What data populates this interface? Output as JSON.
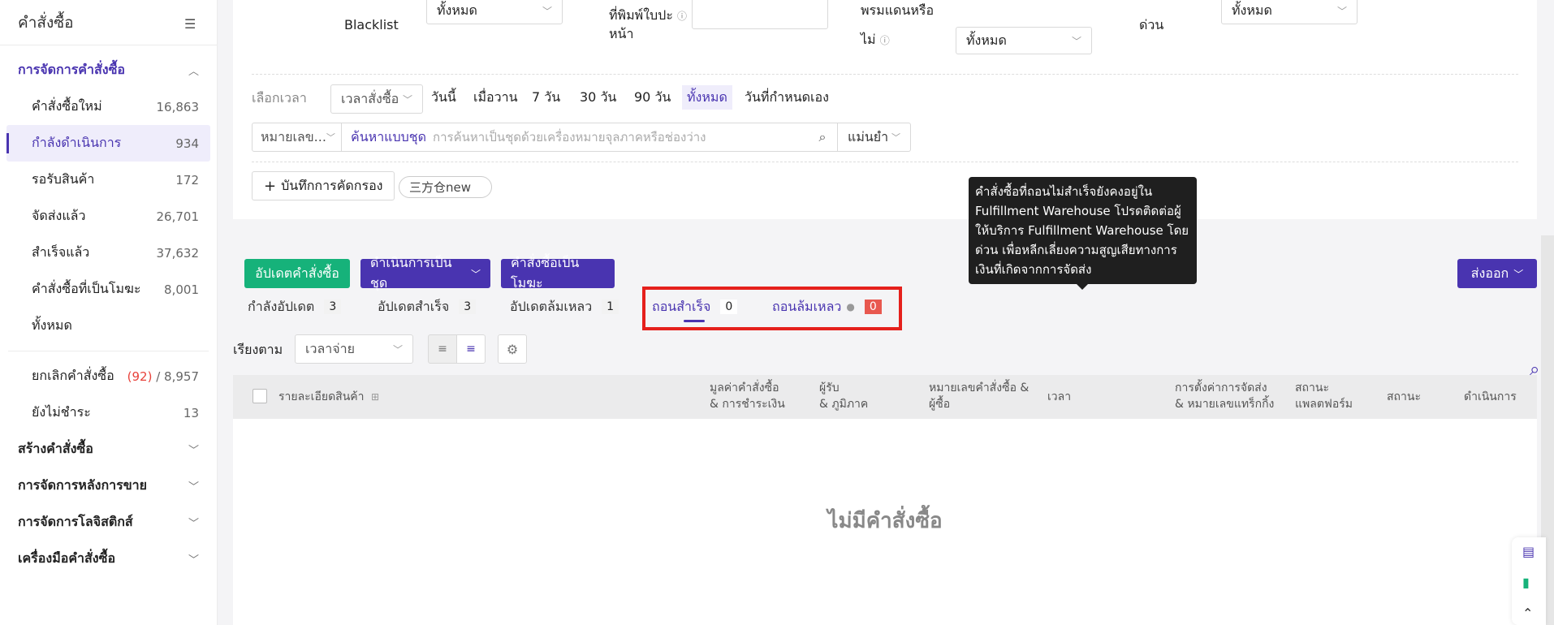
{
  "sidebar": {
    "title": "คำสั่งซื้อ",
    "section1": "การจัดการคำสั่งซื้อ",
    "items": [
      {
        "label": "คำสั่งซื้อใหม่",
        "count": "16,863"
      },
      {
        "label": "กำลังดำเนินการ",
        "count": "934"
      },
      {
        "label": "รอรับสินค้า",
        "count": "172"
      },
      {
        "label": "จัดส่งแล้ว",
        "count": "26,701"
      },
      {
        "label": "สำเร็จแล้ว",
        "count": "37,632"
      },
      {
        "label": "คำสั่งซื้อที่เป็นโมฆะ",
        "count": "8,001"
      },
      {
        "label": "ทั้งหมด",
        "count": ""
      },
      {
        "label": "ยกเลิกคำสั่งซื้อ",
        "count_red": "(92)",
        "count": "8,957"
      },
      {
        "label": "ยังไม่ชำระ",
        "count": "13"
      }
    ],
    "sections": [
      "สร้างคำสั่งซื้อ",
      "การจัดการหลังการขาย",
      "การจัดการโลจิสติกส์",
      "เครื่องมือคำสั่งซื้อ"
    ]
  },
  "filters": {
    "blacklist": "Blacklist",
    "blacklist_val": "ทั้งหมด",
    "printed_l1": "ที่พิมพ์ใบปะ",
    "printed_l2": "หน้า",
    "border_l1": "พรมแดนหรือ",
    "border_l2": "ไม่",
    "border_val": "ทั้งหมด",
    "urgent": "ด่วน",
    "urgent_val": "ทั้งหมด",
    "time_label": "เลือกเวลา",
    "time_select": "เวลาสั่งซื้อ",
    "time_opts": [
      "วันนี้",
      "เมื่อวาน",
      "7 วัน",
      "30 วัน",
      "90 วัน",
      "ทั้งหมด",
      "วันที่กำหนดเอง"
    ],
    "search_type": "หมายเลข...",
    "batch_search": "ค้นหาแบบชุด",
    "search_placeholder": "การค้นหาเป็นชุดด้วยเครื่องหมายจุลภาคหรือช่องว่าง",
    "match": "แม่นยำ",
    "save_filter": "บันทึกการคัดกรอง",
    "chip": "三方仓new"
  },
  "actions": {
    "update": "อัปเดตคำสั่งซื้อ",
    "batch": "ดำเนินการเป็นชุด",
    "void": "คำสั่งซื้อเป็นโมฆะ",
    "export": "ส่งออก"
  },
  "tabs": [
    {
      "label": "กำลังอัปเดต",
      "count": "3"
    },
    {
      "label": "อัปเดตสำเร็จ",
      "count": "3"
    },
    {
      "label": "อัปเดตล้มเหลว",
      "count": "1"
    },
    {
      "label": "ถอนสำเร็จ",
      "count": "0"
    },
    {
      "label": "ถอนล้มเหลว",
      "count": "0"
    }
  ],
  "sort": {
    "label": "เรียงตาม",
    "value": "เวลาจ่าย"
  },
  "table": {
    "headers": [
      "รายละเอียดสินค้า",
      "มูลค่าคำสั่งซื้อ",
      "& การชำระเงิน",
      "ผู้รับ",
      "& ภูมิภาค",
      "หมายเลขคำสั่งซื้อ &",
      "ผู้ซื้อ",
      "เวลา",
      "การตั้งค่าการจัดส่ง",
      "& หมายเลขแทร็กกิ้ง",
      "สถานะ",
      "แพลตฟอร์ม",
      "สถานะ",
      "ดำเนินการ"
    ],
    "empty": "ไม่มีคำสั่งซื้อ"
  },
  "tooltip": {
    "lines": [
      "คำสั่งซื้อที่ถอนไม่สำเร็จยังคงอยู่ใน",
      "Fulfillment Warehouse โปรดติดต่อผู้",
      "ให้บริการ Fulfillment Warehouse โดย",
      "ด่วน เพื่อหลีกเลี่ยงความสูญเสียทางการ",
      "เงินที่เกิดจากการจัดส่ง"
    ]
  },
  "colors": {
    "accent": "#4934b0",
    "green": "#16b27a",
    "red": "#e5201c"
  }
}
